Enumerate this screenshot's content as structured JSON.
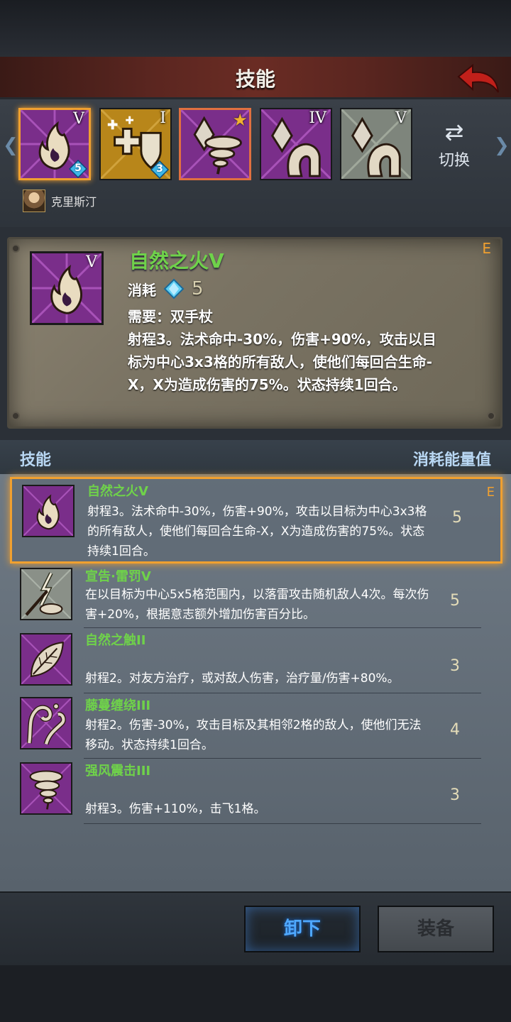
{
  "header": {
    "title": "技能",
    "back_icon": "back-arrow-icon"
  },
  "equipped_slots": [
    {
      "icon": "flame-icon",
      "level": "V",
      "cost_badge": "5",
      "color": "#8a3a9a"
    },
    {
      "icon": "heal-shield-icon",
      "level": "I",
      "cost_badge": "3",
      "color": "#c8941e"
    },
    {
      "icon": "crystal-whirlwind-icon",
      "level": "",
      "star": "★",
      "color": "#8a3a9a"
    },
    {
      "icon": "crystal-arm-icon",
      "level": "IV",
      "color": "#8a3a9a"
    },
    {
      "icon": "crystal-arm-icon",
      "level": "V",
      "color": "#8a9088"
    }
  ],
  "switch": {
    "icon": "swap-arrows-icon",
    "label": "切换"
  },
  "character": {
    "name": "克里斯汀"
  },
  "detail": {
    "name": "自然之火V",
    "level": "V",
    "grade": "E",
    "cost_label": "消耗",
    "cost_value": "5",
    "requirement": "需要：双手杖",
    "description": "射程3。法术命中-30%，伤害+90%，攻击以目标为中心3x3格的所有敌人，使他们每回合生命-X，X为造成伤害的75%。状态持续1回合。"
  },
  "list_header": {
    "left": "技能",
    "right": "消耗能量值"
  },
  "skills": [
    {
      "name": "自然之火V",
      "desc": "射程3。法术命中-30%，伤害+90%，攻击以目标为中心3x3格的所有敌人，使他们每回合生命-X，X为造成伤害的75%。状态持续1回合。",
      "cost": "5",
      "grade": "E",
      "icon": "flame-icon"
    },
    {
      "name": "宣告·雷罚V",
      "desc": "在以目标为中心5x5格范围内，以落雷攻击随机敌人4次。每次伤害+20%，根据意志额外增加伤害百分比。",
      "cost": "5",
      "icon": "lightning-totem-icon"
    },
    {
      "name": "自然之触II",
      "desc": "射程2。对友方治疗，或对敌人伤害，治疗量/伤害+80%。",
      "cost": "3",
      "icon": "leaf-icon"
    },
    {
      "name": "藤蔓缠绕III",
      "desc": "射程2。伤害-30%，攻击目标及其相邻2格的敌人，使他们无法移动。状态持续1回合。",
      "cost": "4",
      "icon": "vine-icon"
    },
    {
      "name": "强风震击III",
      "desc": "射程3。伤害+110%，击飞1格。",
      "cost": "3",
      "icon": "whirlwind-icon"
    }
  ],
  "buttons": {
    "unequip": "卸下",
    "equip": "装备"
  },
  "colors": {
    "skill_name": "#6fd24a",
    "selected": "#f0a030",
    "title_bar": "#6a2c24"
  }
}
